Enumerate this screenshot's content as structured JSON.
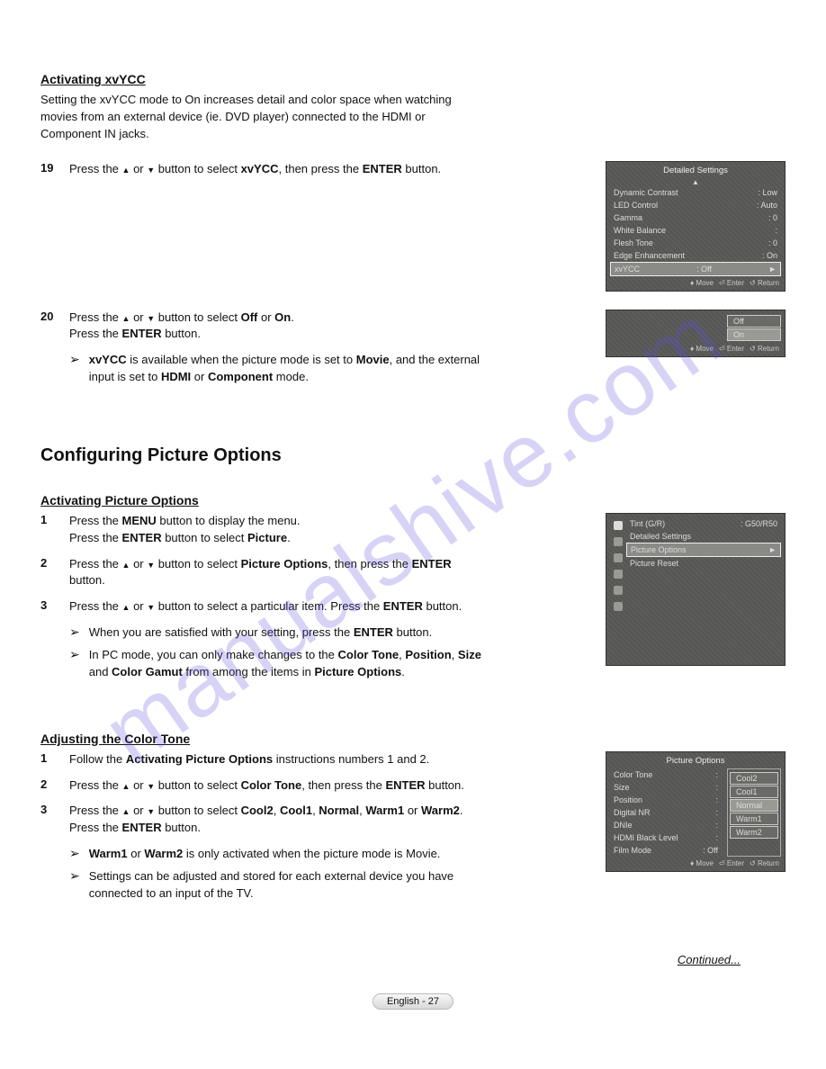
{
  "watermark": "manualshive.com",
  "section1": {
    "heading": "Activating xvYCC",
    "intro": "Setting the xvYCC mode to On increases detail and color space when watching movies from an external device (ie. DVD player) connected to the HDMI or Component IN jacks.",
    "step19": {
      "num": "19",
      "pre": "Press the ",
      "mid": " button to select ",
      "target": "xvYCC",
      "post": ", then press the ",
      "btn": "ENTER",
      "end": " button."
    },
    "step20": {
      "num": "20",
      "line1_pre": "Press the ",
      "line1_mid": " button to select ",
      "off": "Off",
      "or": " or ",
      "on": "On",
      "dot": ".",
      "line2_pre": "Press the ",
      "line2_btn": "ENTER",
      "line2_end": " button."
    },
    "note": {
      "b1": "xvYCC",
      "t1": " is available when the picture mode is set to ",
      "b2": "Movie",
      "t2": ", and the external input is set to ",
      "b3": "HDMI",
      "t3": " or ",
      "b4": "Component",
      "t4": " mode."
    }
  },
  "osd1": {
    "title": "Detailed Settings",
    "rows": [
      {
        "k": "Dynamic Contrast",
        "v": "Low"
      },
      {
        "k": "LED Control",
        "v": "Auto"
      },
      {
        "k": "Gamma",
        "v": "0"
      },
      {
        "k": "White Balance",
        "v": ""
      },
      {
        "k": "Flesh Tone",
        "v": "0"
      },
      {
        "k": "Edge Enhancement",
        "v": "On"
      },
      {
        "k": "xvYCC",
        "v": "Off",
        "sel": true
      }
    ],
    "footer": {
      "move": "Move",
      "enter": "Enter",
      "return": "Return"
    }
  },
  "osd1b": {
    "options": [
      "Off",
      "On"
    ],
    "footer": {
      "move": "Move",
      "enter": "Enter",
      "return": "Return"
    }
  },
  "section2": {
    "bigheading": "Configuring Picture Options",
    "heading": "Activating Picture Options",
    "step1": {
      "num": "1",
      "l1_pre": "Press the ",
      "l1_b": "MENU",
      "l1_post": " button to display the menu.",
      "l2_pre": "Press the ",
      "l2_b": "ENTER",
      "l2_mid": " button to select ",
      "l2_b2": "Picture",
      "l2_end": "."
    },
    "step2": {
      "num": "2",
      "pre": "Press the ",
      "mid": " button to select ",
      "target": "Picture Options",
      "post": ", then press the ",
      "btn": "ENTER",
      "end": " button."
    },
    "step3": {
      "num": "3",
      "pre": "Press the ",
      "mid": " button to select a particular item. Press the ",
      "btn": "ENTER",
      "end": " button."
    },
    "note1": {
      "t1": "When you are satisfied with your setting, press the ",
      "b": "ENTER",
      "t2": " button."
    },
    "note2": {
      "t1": "In PC mode, you can only make changes to the ",
      "b1": "Color Tone",
      "c1": ", ",
      "b2": "Position",
      "c2": ", ",
      "b3": "Size",
      "t2": " and ",
      "b4": "Color Gamut",
      "t3": " from among the items in ",
      "b5": "Picture Options",
      "t4": "."
    }
  },
  "osd2": {
    "top": {
      "k": "Tint (G/R)",
      "v": "G50/R50"
    },
    "rows": [
      {
        "k": "Detailed Settings"
      },
      {
        "k": "Picture Options",
        "sel": true
      },
      {
        "k": "Picture Reset"
      }
    ],
    "sidebar_label": "Picture"
  },
  "section3": {
    "heading": "Adjusting the Color Tone",
    "step1": {
      "num": "1",
      "pre": "Follow the ",
      "b": "Activating Picture Options",
      "post": " instructions numbers 1 and 2."
    },
    "step2": {
      "num": "2",
      "pre": "Press the ",
      "mid": " button to select ",
      "target": "Color Tone",
      "post": ", then press the ",
      "btn": "ENTER",
      "end": " button."
    },
    "step3": {
      "num": "3",
      "pre": "Press the ",
      "mid": " button to select ",
      "o1": "Cool2",
      "c": ", ",
      "o2": "Cool1",
      "o3": "Normal",
      "o4": "Warm1",
      "or": " or ",
      "o5": "Warm2",
      "dot": ".",
      "l2_pre": "Press the ",
      "l2_b": "ENTER",
      "l2_end": " button."
    },
    "note1": {
      "b1": "Warm1",
      "t1": " or ",
      "b2": "Warm2",
      "t2": " is only activated when the picture mode is Movie."
    },
    "note2": {
      "t": "Settings can be adjusted and stored for each external device you have connected to an input of the TV."
    }
  },
  "osd3": {
    "title": "Picture Options",
    "left": [
      {
        "k": "Color Tone",
        "v": ""
      },
      {
        "k": "Size",
        "v": ""
      },
      {
        "k": "Position",
        "v": ""
      },
      {
        "k": "Digital NR",
        "v": ""
      },
      {
        "k": "DNIe",
        "v": ""
      },
      {
        "k": "HDMI Black Level",
        "v": ""
      },
      {
        "k": "Film Mode",
        "v": "Off"
      }
    ],
    "right": [
      "Cool2",
      "Cool1",
      "Normal",
      "Warm1",
      "Warm2"
    ],
    "right_sel": "Normal",
    "footer": {
      "move": "Move",
      "enter": "Enter",
      "return": "Return"
    }
  },
  "continued": "Continued...",
  "pagenum": "English - 27"
}
